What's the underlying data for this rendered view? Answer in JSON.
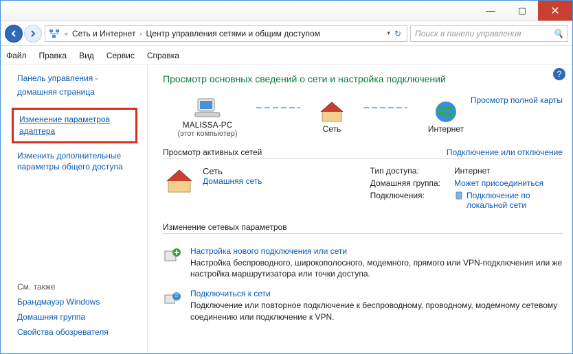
{
  "titlebar": {
    "min": "—",
    "max": "▢",
    "close": "✕"
  },
  "address": {
    "back_chev": "«",
    "path1": "Сеть и Интернет",
    "sep": "›",
    "path2": "Центр управления сетями и общим доступом",
    "dropdown": "▾",
    "refresh": "↻"
  },
  "search": {
    "placeholder": "Поиск в панели управления",
    "icon": "🔍"
  },
  "menu": [
    "Файл",
    "Правка",
    "Вид",
    "Сервис",
    "Справка"
  ],
  "sidebar": {
    "cp_home1": "Панель управления -",
    "cp_home2": "домашняя страница",
    "adapter_link": "Изменение параметров адаптера",
    "sharing_link": "Изменить дополнительные параметры общего доступа",
    "see_also": "См. также",
    "firewall": "Брандмауэр Windows",
    "homegroup": "Домашняя группа",
    "ie_options": "Свойства обозревателя"
  },
  "main": {
    "heading": "Просмотр основных сведений о сети и настройка подключений",
    "full_map": "Просмотр полной карты",
    "nodes": {
      "pc": "MALISSA-PC",
      "pc_sub": "(этот компьютер)",
      "net": "Сеть",
      "inet": "Интернет"
    },
    "active_hd": "Просмотр активных сетей",
    "active_link": "Подключение или отключение",
    "net_name": "Сеть",
    "net_type": "Домашняя сеть",
    "labels": {
      "access": "Тип доступа:",
      "homegroup": "Домашняя группа:",
      "conn": "Подключения:"
    },
    "values": {
      "access": "Интернет",
      "homegroup": "Может присоединиться",
      "conn": "Подключение по локальной сети"
    },
    "change_hd": "Изменение сетевых параметров",
    "tasks": [
      {
        "title": "Настройка нового подключения или сети",
        "desc": "Настройка беспроводного, широкополосного, модемного, прямого или VPN-подключения или же настройка маршрутизатора или точки доступа."
      },
      {
        "title": "Подключиться к сети",
        "desc": "Подключение или повторное подключение к беспроводному, проводному, модемному сетевому соединению или подключение к VPN."
      }
    ]
  }
}
